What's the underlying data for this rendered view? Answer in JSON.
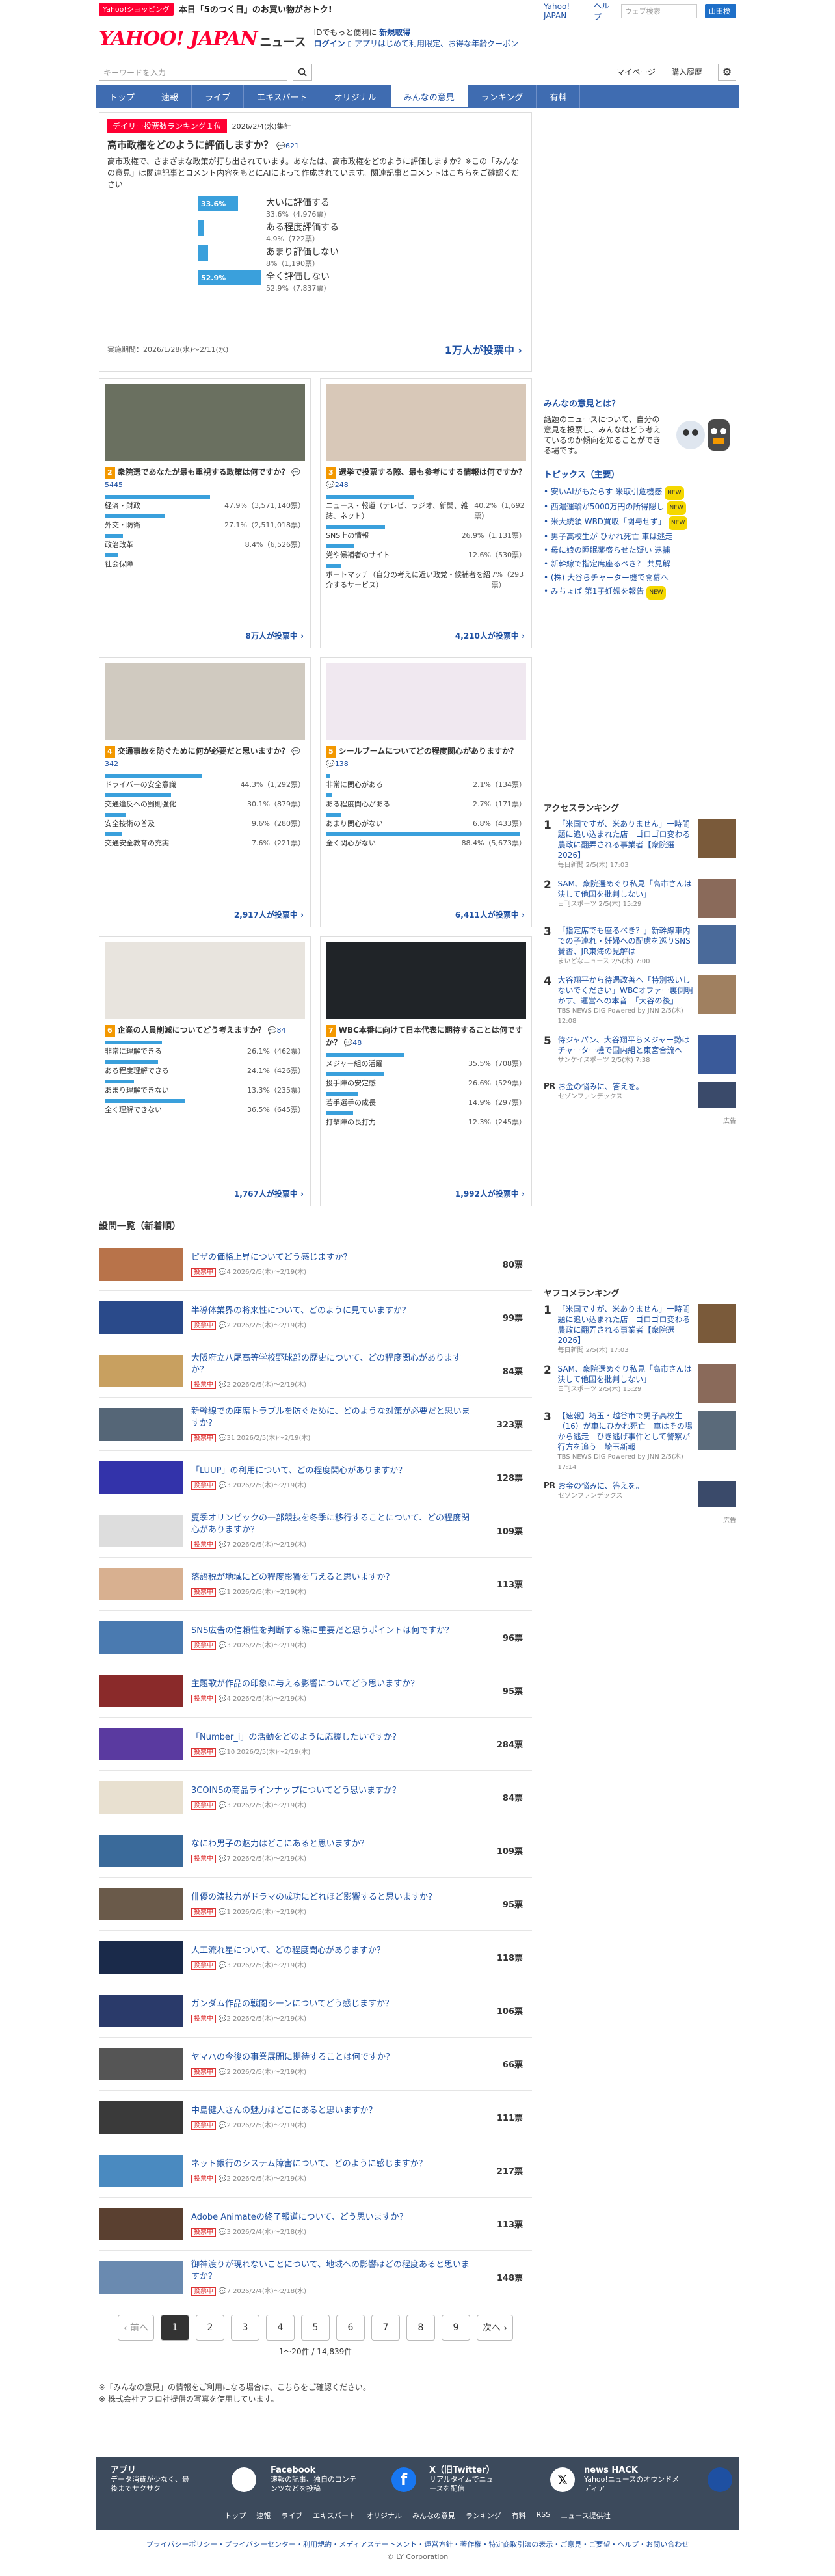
{
  "topbar": {
    "shop": "Yahoo!ショッピング",
    "promo": "本日「5のつく日」のお買い物がおトク!",
    "links": [
      "Yahoo! JAPAN",
      "ヘルプ"
    ],
    "search_placeholder": "ウェブ検索",
    "search_btn": "山田検索"
  },
  "header": {
    "logo": "YAHOO! JAPAN",
    "news": "ニュース",
    "msg1": "IDでもっと便利に",
    "msg1b": "新規取得",
    "login": "ログイン",
    "msg2": "アプリはじめて利用限定、お得な年齢クーポン"
  },
  "search": {
    "placeholder": "キーワードを入力",
    "links": [
      "マイページ",
      "購入履歴"
    ]
  },
  "nav": [
    "トップ",
    "速報",
    "ライブ",
    "エキスパート",
    "オリジナル",
    "みんなの意見",
    "ランキング",
    "有料"
  ],
  "featured": {
    "badge": "デイリー投票数ランキング１位",
    "date": "2026/2/4(水)集計",
    "question": "高市政権をどのように評価しますか？",
    "comments": "621",
    "desc": "高市政権で、さまざまな政策が打ち出されています。あなたは、高市政権をどのように評価しますか？※この「みんなの意見」は関連記事とコメント内容をもとにAIによって作成されています。関連記事とコメントはこちらをご確認ください",
    "options": [
      {
        "label": "大いに評価する",
        "pct": "33.6%",
        "sub": "33.6%（4,976票）",
        "v": 33.6
      },
      {
        "label": "ある程度評価する",
        "pct": "",
        "sub": "4.9%（722票）",
        "v": 4.9
      },
      {
        "label": "あまり評価しない",
        "pct": "",
        "sub": "8%（1,190票）",
        "v": 8
      },
      {
        "label": "全く評価しない",
        "pct": "52.9%",
        "sub": "52.9%（7,837票）",
        "v": 52.9
      }
    ],
    "period": "実施期間：2026/1/28(水)〜2/11(水)",
    "votes": "1万人が投票中 ›"
  },
  "cards": [
    {
      "num": "2",
      "q": "衆院選であなたが最も重視する政策は何ですか？",
      "cm": "5445",
      "opts": [
        {
          "l": "経済・財政",
          "p": "47.9%（3,571,140票）",
          "v": 47.9
        },
        {
          "l": "外交・防衛",
          "p": "27.1%（2,511,018票）",
          "v": 27.1
        },
        {
          "l": "政治改革",
          "p": "8.4%（6,526票）",
          "v": 8.4
        },
        {
          "l": "社会保障",
          "p": "",
          "v": 6
        }
      ],
      "votes": "8万人が投票中 ›"
    },
    {
      "num": "3",
      "q": "選挙で投票する際、最も参考にする情報は何ですか？",
      "cm": "248",
      "opts": [
        {
          "l": "ニュース・報道（テレビ、ラジオ、新聞、雑誌、ネット）",
          "p": "40.2%（1,692票）",
          "v": 40.2
        },
        {
          "l": "SNS上の情報",
          "p": "26.9%（1,131票）",
          "v": 26.9
        },
        {
          "l": "党や候補者のサイト",
          "p": "12.6%（530票）",
          "v": 12.6
        },
        {
          "l": "ボートマッチ（自分の考えに近い政党・候補者を紹介するサービス）",
          "p": "7%（293票）",
          "v": 7
        }
      ],
      "votes": "4,210人が投票中 ›"
    },
    {
      "num": "4",
      "q": "交通事故を防ぐために何が必要だと思いますか？",
      "cm": "342",
      "opts": [
        {
          "l": "ドライバーの安全意識",
          "p": "44.3%（1,292票）",
          "v": 44.3
        },
        {
          "l": "交通違反への罰則強化",
          "p": "30.1%（879票）",
          "v": 30.1
        },
        {
          "l": "安全技術の普及",
          "p": "9.6%（280票）",
          "v": 9.6
        },
        {
          "l": "交通安全教育の充実",
          "p": "7.6%（221票）",
          "v": 7.6
        }
      ],
      "votes": "2,917人が投票中 ›"
    },
    {
      "num": "5",
      "q": "シールブームについてどの程度関心がありますか？",
      "cm": "138",
      "opts": [
        {
          "l": "非常に関心がある",
          "p": "2.1%（134票）",
          "v": 2.1
        },
        {
          "l": "ある程度関心がある",
          "p": "2.7%（171票）",
          "v": 2.7
        },
        {
          "l": "あまり関心がない",
          "p": "6.8%（433票）",
          "v": 6.8
        },
        {
          "l": "全く関心がない",
          "p": "88.4%（5,673票）",
          "v": 88.4
        }
      ],
      "votes": "6,411人が投票中 ›"
    },
    {
      "num": "6",
      "q": "企業の人員削減についてどう考えますか？",
      "cm": "84",
      "opts": [
        {
          "l": "非常に理解できる",
          "p": "26.1%（462票）",
          "v": 26.1
        },
        {
          "l": "ある程度理解できる",
          "p": "24.1%（426票）",
          "v": 24.1
        },
        {
          "l": "あまり理解できない",
          "p": "13.3%（235票）",
          "v": 13.3
        },
        {
          "l": "全く理解できない",
          "p": "36.5%（645票）",
          "v": 36.5
        }
      ],
      "votes": "1,767人が投票中 ›"
    },
    {
      "num": "7",
      "q": "WBC本番に向けて日本代表に期待することは何ですか？",
      "cm": "48",
      "opts": [
        {
          "l": "メジャー組の活躍",
          "p": "35.5%（708票）",
          "v": 35.5
        },
        {
          "l": "投手陣の安定感",
          "p": "26.6%（529票）",
          "v": 26.6
        },
        {
          "l": "若手選手の成長",
          "p": "14.9%（297票）",
          "v": 14.9
        },
        {
          "l": "打撃陣の長打力",
          "p": "12.3%（245票）",
          "v": 12.3
        }
      ],
      "votes": "1,992人が投票中 ›"
    }
  ],
  "list_title": "設問一覧（新着順）",
  "list": [
    {
      "t": "ピザの価格上昇についてどう感じますか？",
      "c": "4",
      "d": "2026/2/5(木)〜2/19(木)",
      "n": "80票",
      "col": "#b8734a"
    },
    {
      "t": "半導体業界の将来性について、どのように見ていますか？",
      "c": "2",
      "d": "2026/2/5(木)〜2/19(木)",
      "n": "99票",
      "col": "#2a4a8a"
    },
    {
      "t": "大阪府立八尾高等学校野球部の歴史について、どの程度関心がありますか？",
      "c": "2",
      "d": "2026/2/5(木)〜2/19(木)",
      "n": "84票",
      "col": "#c8a060"
    },
    {
      "t": "新幹線での座席トラブルを防ぐために、どのような対策が必要だと思いますか？",
      "c": "31",
      "d": "2026/2/5(木)〜2/19(木)",
      "n": "323票",
      "col": "#556677"
    },
    {
      "t": "「LUUP」の利用について、どの程度関心がありますか？",
      "c": "3",
      "d": "2026/2/5(木)〜2/19(木)",
      "n": "128票",
      "col": "#3333aa"
    },
    {
      "t": "夏季オリンピックの一部競技を冬季に移行することについて、どの程度関心がありますか？",
      "c": "7",
      "d": "2026/2/5(木)〜2/19(木)",
      "n": "109票",
      "col": "#dddddd"
    },
    {
      "t": "落語税が地域にどの程度影響を与えると思いますか？",
      "c": "1",
      "d": "2026/2/5(木)〜2/19(木)",
      "n": "113票",
      "col": "#d8b090"
    },
    {
      "t": "SNS広告の信頼性を判断する際に重要だと思うポイントは何ですか？",
      "c": "3",
      "d": "2026/2/5(木)〜2/19(木)",
      "n": "96票",
      "col": "#4a7ab0"
    },
    {
      "t": "主題歌が作品の印象に与える影響についてどう思いますか？",
      "c": "4",
      "d": "2026/2/5(木)〜2/19(木)",
      "n": "95票",
      "col": "#8a2a2a"
    },
    {
      "t": "「Number_i」の活動をどのように応援したいですか？",
      "c": "10",
      "d": "2026/2/5(木)〜2/19(木)",
      "n": "284票",
      "col": "#5a3aa0"
    },
    {
      "t": "3COINSの商品ラインナップについてどう思いますか？",
      "c": "3",
      "d": "2026/2/5(木)〜2/19(木)",
      "n": "84票",
      "col": "#e8e0d0"
    },
    {
      "t": "なにわ男子の魅力はどこにあると思いますか？",
      "c": "7",
      "d": "2026/2/5(木)〜2/19(木)",
      "n": "109票",
      "col": "#3a6a9a"
    },
    {
      "t": "俳優の演技力がドラマの成功にどれほど影響すると思いますか？",
      "c": "1",
      "d": "2026/2/5(木)〜2/19(木)",
      "n": "95票",
      "col": "#6a5a4a"
    },
    {
      "t": "人工流れ星について、どの程度関心がありますか？",
      "c": "3",
      "d": "2026/2/5(木)〜2/19(木)",
      "n": "118票",
      "col": "#1a2a4a"
    },
    {
      "t": "ガンダム作品の戦闘シーンについてどう感じますか？",
      "c": "2",
      "d": "2026/2/5(木)〜2/19(木)",
      "n": "106票",
      "col": "#2a3a6a"
    },
    {
      "t": "ヤマハの今後の事業展開に期待することは何ですか？",
      "c": "2",
      "d": "2026/2/5(木)〜2/19(木)",
      "n": "66票",
      "col": "#555555"
    },
    {
      "t": "中島健人さんの魅力はどこにあると思いますか？",
      "c": "2",
      "d": "2026/2/5(木)〜2/19(木)",
      "n": "111票",
      "col": "#3a3a3a"
    },
    {
      "t": "ネット銀行のシステム障害について、どのように感じますか？",
      "c": "2",
      "d": "2026/2/5(木)〜2/19(木)",
      "n": "217票",
      "col": "#4a8ac0"
    },
    {
      "t": "Adobe Animateの終了報道について、どう思いますか？",
      "c": "3",
      "d": "2026/2/4(水)〜2/18(水)",
      "n": "113票",
      "col": "#5a4030"
    },
    {
      "t": "御神渡りが現れないことについて、地域への影響はどの程度あると思いますか？",
      "c": "7",
      "d": "2026/2/4(水)〜2/18(水)",
      "n": "148票",
      "col": "#6a8ab0"
    }
  ],
  "pager": {
    "prev": "‹ 前へ",
    "pages": [
      "1",
      "2",
      "3",
      "4",
      "5",
      "6",
      "7",
      "8",
      "9"
    ],
    "next": "次へ ›",
    "meta": "1〜20件 / 14,839件"
  },
  "notes": [
    "※「みんなの意見」の情報をご利用になる場合は、こちらをご確認ください。",
    "※ 株式会社アフロ社提供の写真を使用しています。"
  ],
  "right": {
    "about_title": "みんなの意見とは？",
    "about_text": "話題のニュースについて、自分の意見を投票し、みんなはどう考えているのか傾向を知ることができる場です。",
    "topics_title": "トピックス（主要）",
    "topics": [
      {
        "t": "安いAIがもたらす 米取引危機感",
        "n": true
      },
      {
        "t": "西濃運輸が5000万円の所得隠し",
        "n": true
      },
      {
        "t": "米大統領 WBD買収「関与せず」",
        "n": true
      },
      {
        "t": "男子高校生が ひかれ死亡 車は逃走",
        "n": false
      },
      {
        "t": "母に娘の睡眠薬盛らせた疑い 逮捕",
        "n": false
      },
      {
        "t": "新幹線で指定席座るべき？ 共見解",
        "n": false
      },
      {
        "t": "(株) 大谷らチャーター機で開幕へ",
        "n": false
      },
      {
        "t": "みちょぱ 第1子妊娠を報告",
        "n": true
      }
    ],
    "access_title": "アクセスランキング",
    "access": [
      {
        "t": "「米国ですが、米ありません」一時問題に追い込まれた店　ゴロゴロ変わる農政に翻弄される事業者【衆院選2026】",
        "s": "毎日新聞 2/5(木) 17:03",
        "col": "#7a5a3a"
      },
      {
        "t": "SAM、衆院選めぐり私見「高市さんは決して他国を批判しない」",
        "s": "日刊スポーツ 2/5(木) 15:29",
        "col": "#8a6a5a"
      },
      {
        "t": "「指定席でも座るべき？」新幹線車内での子連れ・妊婦への配慮を巡りSNS賛否、JR東海の見解は",
        "s": "まいどなニュース 2/5(木) 7:00",
        "col": "#4a6a9a"
      },
      {
        "t": "大谷翔平から待遇改善へ「特別扱いしないでください」WBCオファー裏側明かす、運営への本音　「大谷の後」",
        "s": "TBS NEWS DIG Powered by JNN 2/5(木) 12:08",
        "col": "#a08060"
      },
      {
        "t": "侍ジャパン、大谷翔平らメジャー勢はチャーター機で国内組と東宮合流へ",
        "s": "サンケイスポーツ 2/5(木) 7:38",
        "col": "#3a5a9a"
      }
    ],
    "pr": {
      "t": "お金の悩みに、答えを。",
      "s": "セゾンファンデックス"
    },
    "yafoo_title": "ヤフコメランキング",
    "yafoo": [
      {
        "t": "「米国ですが、米ありません」一時問題に追い込まれた店　ゴロゴロ変わる農政に翻弄される事業者【衆院選2026】",
        "s": "毎日新聞 2/5(木) 17:03",
        "col": "#7a5a3a"
      },
      {
        "t": "SAM、衆院選めぐり私見「高市さんは決して他国を批判しない」",
        "s": "日刊スポーツ 2/5(木) 15:29",
        "col": "#8a6a5a"
      },
      {
        "t": "【速報】埼玉・越谷市で男子高校生（16）が車にひかれ死亡　車はその場から逃走　ひき逃げ事件として警察が行方を追う　埼玉新報",
        "s": "TBS NEWS DIG Powered by JNN 2/5(木) 17:14",
        "col": "#5a6a7a"
      }
    ],
    "pr2": {
      "t": "お金の悩みに、答えを。",
      "s": "セゾンファンデックス"
    },
    "ad": "広告"
  },
  "footer": {
    "cols": [
      {
        "t": "アプリ",
        "d": "データ消費が少なく、最後までサクサク"
      },
      {
        "t": "Facebook",
        "d": "速報の記事、独自のコンテンツなどを投稿"
      },
      {
        "t": "X（旧Twitter）",
        "d": "リアルタイムでニュースを配信"
      },
      {
        "t": "news HACK",
        "d": "Yahoo!ニュースのオウンドメディア"
      }
    ],
    "nav": [
      "トップ",
      "速報",
      "ライブ",
      "エキスパート",
      "オリジナル",
      "みんなの意見",
      "ランキング",
      "有料",
      "RSS",
      "ニュース提供社"
    ],
    "links": "プライバシーポリシー・プライバシーセンター・利用規約・メディアステートメント・運営方針・著作権・特定商取引法の表示・ご意見・ご要望・ヘルプ・お問い合わせ",
    "copy": "© LY Corporation"
  }
}
